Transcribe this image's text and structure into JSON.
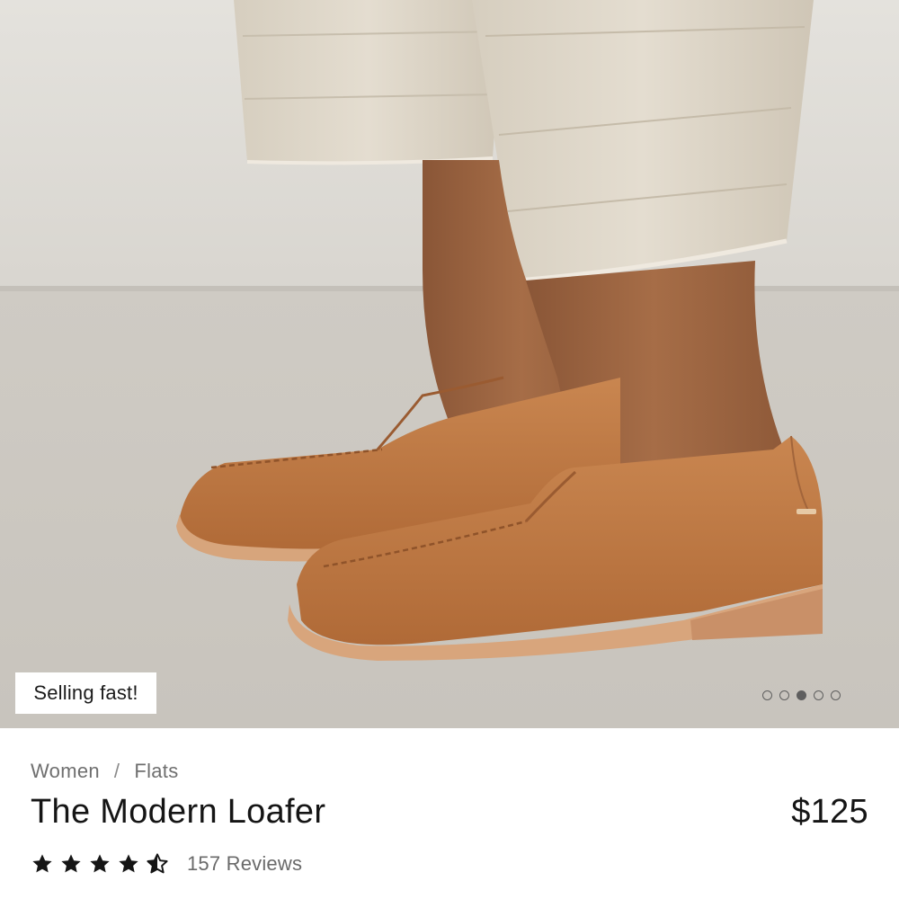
{
  "product": {
    "badge": "Selling fast!",
    "breadcrumb": [
      "Women",
      "Flats"
    ],
    "breadcrumb_separator": "/",
    "title": "The Modern Loafer",
    "price": "$125",
    "rating": 4.5,
    "rating_max": 5,
    "reviews_label": "157 Reviews"
  },
  "gallery": {
    "image_count": 5,
    "active_index": 3
  },
  "colors": {
    "leather": "#c07a43",
    "sole": "#d8a57c",
    "text_primary": "#151515",
    "text_secondary": "#6f6f6f"
  },
  "icons": {
    "star": "star-icon",
    "half_star": "star-half-icon"
  }
}
